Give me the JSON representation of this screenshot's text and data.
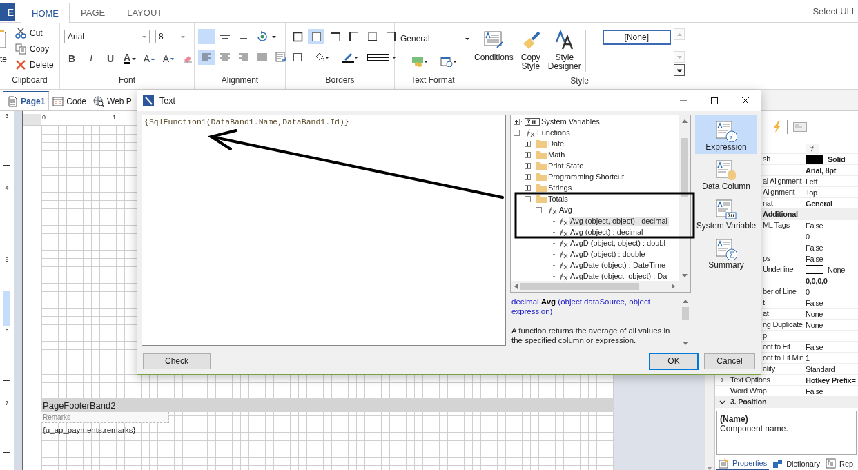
{
  "ribbon": {
    "file_tab": "E",
    "tabs": [
      {
        "label": "HOME",
        "selected": true
      },
      {
        "label": "PAGE",
        "selected": false
      },
      {
        "label": "LAYOUT",
        "selected": false
      }
    ],
    "ui_language": "Select UI L",
    "clipboard": {
      "label": "Clipboard",
      "paste": "te",
      "actions": [
        {
          "kind": "cut",
          "label": "Cut"
        },
        {
          "kind": "copy",
          "label": "Copy"
        },
        {
          "kind": "delete",
          "label": "Delete"
        }
      ]
    },
    "font": {
      "label": "Font",
      "family": "Arial",
      "size": "8",
      "buttons": [
        {
          "kind": "bold",
          "text": "B"
        },
        {
          "kind": "italic",
          "text": "I"
        },
        {
          "kind": "underline",
          "text": "U"
        },
        {
          "kind": "color",
          "text": "A"
        },
        {
          "kind": "grow",
          "text": "A"
        },
        {
          "kind": "shrink",
          "text": "A"
        },
        {
          "kind": "clear"
        }
      ]
    },
    "alignment": {
      "label": "Alignment",
      "vertical": [
        {
          "kind": "top",
          "selected": true
        },
        {
          "kind": "middle",
          "selected": false
        },
        {
          "kind": "bottom",
          "selected": false
        },
        {
          "kind": "rotate"
        }
      ],
      "horizontal": [
        {
          "kind": "left",
          "selected": true
        },
        {
          "kind": "center",
          "selected": false
        },
        {
          "kind": "right",
          "selected": false
        },
        {
          "kind": "justify",
          "selected": false
        },
        {
          "kind": "wrap"
        }
      ]
    },
    "borders": {
      "label": "Borders",
      "sides": [
        {
          "kind": "all",
          "selected": false
        },
        {
          "kind": "none",
          "selected": true
        },
        {
          "kind": "top",
          "selected": false
        },
        {
          "kind": "left",
          "selected": false
        },
        {
          "kind": "bottom",
          "selected": false
        },
        {
          "kind": "right",
          "selected": false
        }
      ],
      "tools": [
        {
          "kind": "box"
        },
        {
          "kind": "fill"
        },
        {
          "kind": "pen"
        },
        {
          "kind": "style"
        }
      ]
    },
    "text_format": {
      "label": "Text Format",
      "format": "General"
    },
    "style": {
      "label": "Style",
      "buttons": [
        {
          "kind": "conditions",
          "label": "Conditions"
        },
        {
          "kind": "copy",
          "label": "Copy Style"
        },
        {
          "kind": "designer",
          "label": "Style Designer"
        }
      ],
      "selected_style": "[None]"
    }
  },
  "page_tabs": [
    {
      "kind": "page",
      "label": "Page1",
      "selected": true
    },
    {
      "kind": "code",
      "label": "Code",
      "selected": false
    },
    {
      "kind": "web",
      "label": "Web P",
      "selected": false
    }
  ],
  "rulers": {
    "vertical": [
      "3",
      "4",
      "5",
      "6",
      "7"
    ],
    "horizontal": [
      "0",
      "1"
    ]
  },
  "report": {
    "band": "PageFooterBand2",
    "label": "Remarks",
    "field": "{u_ap_payments.remarks}"
  },
  "properties": {
    "rows": [
      {
        "kind": "button"
      },
      {
        "kind": "color",
        "name": "sh",
        "color": "#000000",
        "value": "Solid",
        "bold": true
      },
      {
        "kind": "property",
        "value": "Arial, 8pt",
        "bold": true
      },
      {
        "kind": "property",
        "name": "al Alignment",
        "value": "Left",
        "bold": false
      },
      {
        "kind": "property",
        "name": "Alignment",
        "value": "Top",
        "bold": false
      },
      {
        "kind": "property",
        "name": "nat",
        "value": "General",
        "bold": true
      },
      {
        "kind": "category",
        "name": "Additional"
      },
      {
        "kind": "property",
        "name": "ML Tags",
        "value": "False",
        "bold": false
      },
      {
        "kind": "property",
        "value": "0",
        "bold": false
      },
      {
        "kind": "property",
        "value": "False",
        "bold": false
      },
      {
        "kind": "property",
        "name": "ps",
        "value": "False",
        "bold": false
      },
      {
        "kind": "color",
        "name": "Underline",
        "color": "#ffffff",
        "value": "None",
        "bold": false
      },
      {
        "kind": "property",
        "value": "0,0,0,0",
        "bold": true
      },
      {
        "kind": "property",
        "name": "ber of Line",
        "value": "0",
        "bold": false
      },
      {
        "kind": "property",
        "name": "t",
        "value": "False",
        "bold": false
      },
      {
        "kind": "property",
        "name": "at",
        "value": "None",
        "bold": false
      },
      {
        "kind": "property",
        "name": "ng Duplicate",
        "value": "None",
        "bold": false
      },
      {
        "kind": "property",
        "name": "p"
      },
      {
        "kind": "property",
        "name": "ont to Fit",
        "value": "False",
        "bold": false
      },
      {
        "kind": "property",
        "name": "ont to Fit Min",
        "value": "1",
        "bold": false
      },
      {
        "kind": "property",
        "name": "ality",
        "value": "Standard",
        "bold": false
      },
      {
        "kind": "expandable",
        "name": "Text Options",
        "value": "Hotkey Prefix=",
        "bold": true,
        "expanded": false
      },
      {
        "kind": "property",
        "name": "Word Wrap",
        "value": "False",
        "bold": false
      },
      {
        "kind": "category",
        "name": "3. Position",
        "expanded": true
      }
    ],
    "description": {
      "title": "(Name)",
      "text": "Component name."
    },
    "tabs": [
      {
        "kind": "properties",
        "label": "Properties",
        "selected": true
      },
      {
        "kind": "dictionary",
        "label": "Dictionary",
        "selected": false
      },
      {
        "kind": "report",
        "label": "Rep",
        "selected": false
      }
    ]
  },
  "dialog": {
    "title": "Text",
    "expression": "{SqlFunction1(DataBand1.Name,DataBand1.Id)}",
    "tree": [
      {
        "kind": "sysvar",
        "label": "System Variables",
        "expanded": false,
        "selected": false
      },
      {
        "kind": "function",
        "label": "Functions",
        "expanded": true,
        "selected": false,
        "children": [
          {
            "kind": "folder",
            "label": "Date",
            "expanded": false,
            "selected": false
          },
          {
            "kind": "folder",
            "label": "Math",
            "expanded": false,
            "selected": false
          },
          {
            "kind": "folder",
            "label": "Print State",
            "expanded": false,
            "selected": false
          },
          {
            "kind": "folder",
            "label": "Programming Shortcut",
            "expanded": false,
            "selected": false
          },
          {
            "kind": "folder",
            "label": "Strings",
            "expanded": false,
            "selected": false
          },
          {
            "kind": "folder",
            "label": "Totals",
            "expanded": true,
            "selected": false,
            "children": [
              {
                "kind": "function",
                "label": "Avg",
                "expanded": true,
                "selected": false,
                "children": [
                  {
                    "kind": "function",
                    "label": "Avg (object, object) : decimal",
                    "selected": true
                  },
                  {
                    "kind": "function",
                    "label": "Avg (object) : decimal",
                    "selected": false
                  },
                  {
                    "kind": "function",
                    "label": "AvgD (object, object) : doubl",
                    "selected": false
                  },
                  {
                    "kind": "function",
                    "label": "AvgD (object) : double",
                    "selected": false
                  },
                  {
                    "kind": "function",
                    "label": "AvgDate (object) : DateTime",
                    "selected": false
                  },
                  {
                    "kind": "function",
                    "label": "AvgDate (object, object) : Da",
                    "selected": false
                  }
                ]
              }
            ]
          }
        ]
      }
    ],
    "description": {
      "signature": "decimal  **Avg** (object dataSource, object expression)",
      "text": "A function returns the average of all values in the specified column or expression."
    },
    "modes": [
      {
        "kind": "expression",
        "label": "Expression",
        "selected": true
      },
      {
        "kind": "column",
        "label": "Data Column",
        "selected": false
      },
      {
        "kind": "sysvar",
        "label": "System Variable",
        "selected": false
      },
      {
        "kind": "summary",
        "label": "Summary",
        "selected": false
      }
    ],
    "buttons": {
      "check": "Check",
      "ok": "OK",
      "cancel": "Cancel"
    }
  }
}
